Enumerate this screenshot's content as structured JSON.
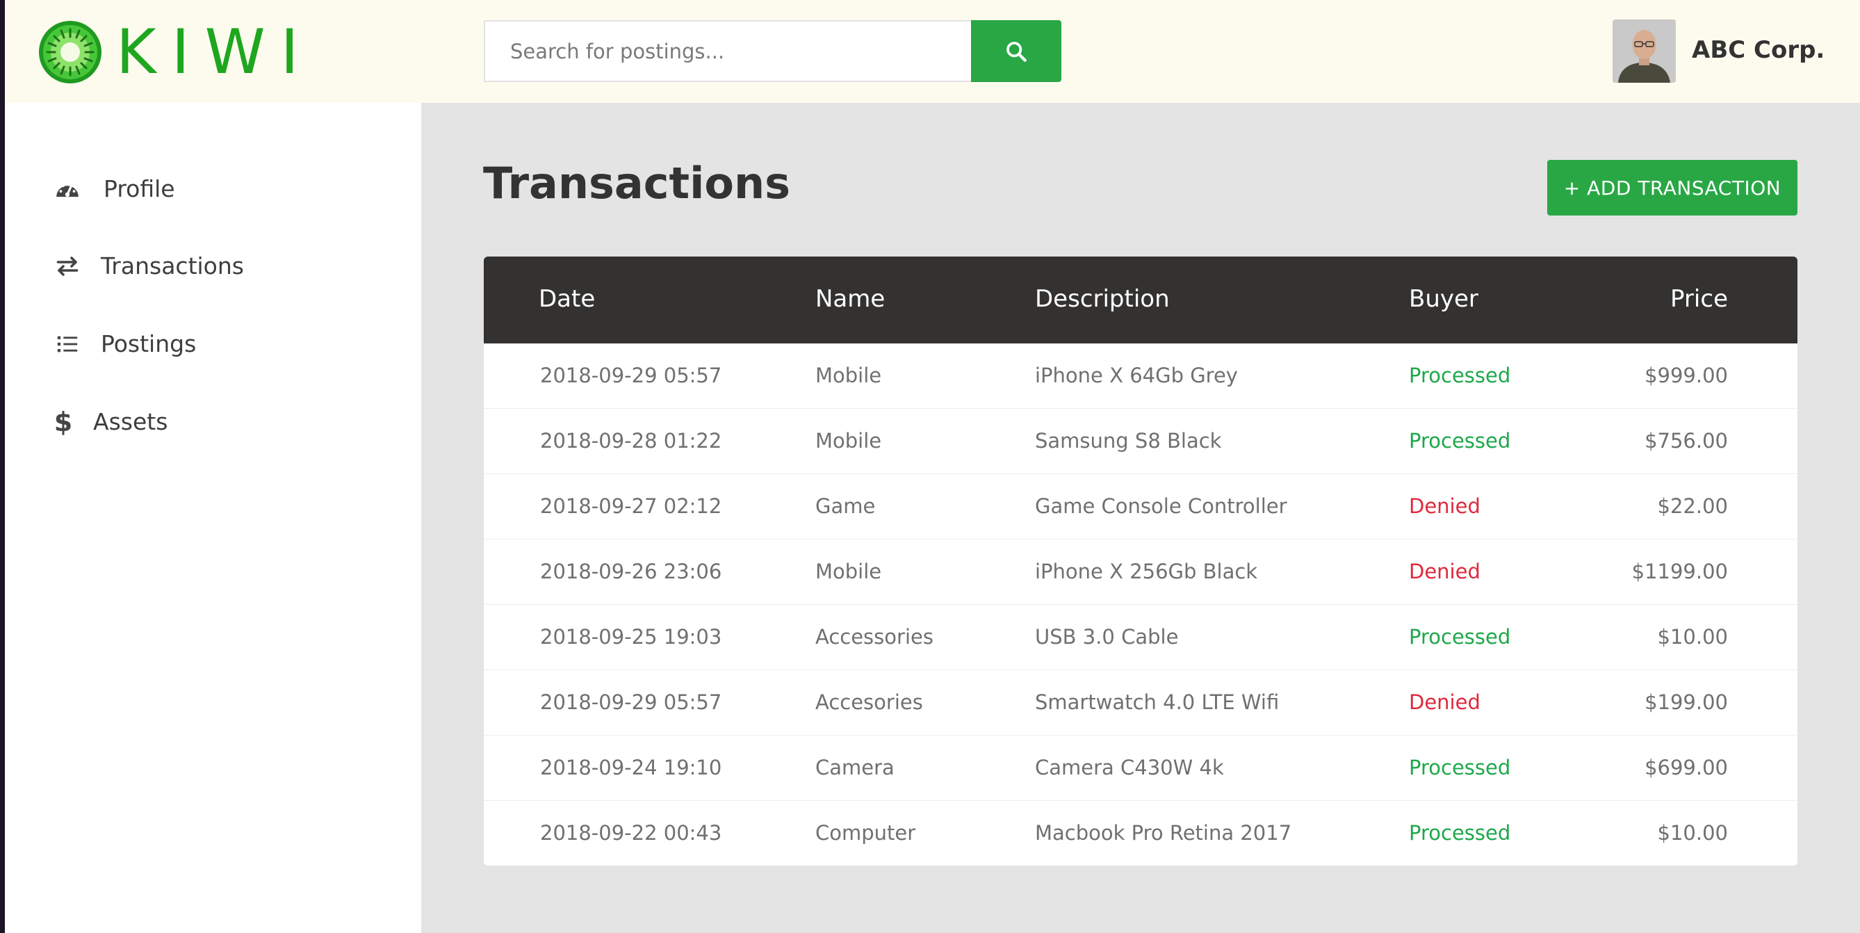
{
  "app": {
    "brand": "KIWI",
    "logo_icon": "kiwi-fruit-logo"
  },
  "header": {
    "search_placeholder": "Search for postings...",
    "search_icon": "search-icon",
    "company_name": "ABC Corp."
  },
  "sidebar": {
    "items": [
      {
        "label": "Profile",
        "icon": "dashboard-gauge-icon"
      },
      {
        "label": "Transactions",
        "icon": "exchange-arrows-icon"
      },
      {
        "label": "Postings",
        "icon": "list-icon"
      },
      {
        "label": "Assets",
        "icon": "dollar-icon"
      }
    ]
  },
  "main": {
    "title": "Transactions",
    "add_button": "+ ADD TRANSACTION",
    "columns": {
      "date": "Date",
      "name": "Name",
      "description": "Description",
      "buyer": "Buyer",
      "price": "Price"
    },
    "rows": [
      {
        "date": "2018-09-29 05:57",
        "name": "Mobile",
        "description": "iPhone X 64Gb Grey",
        "buyer": "Processed",
        "price": "$999.00"
      },
      {
        "date": "2018-09-28 01:22",
        "name": "Mobile",
        "description": "Samsung S8 Black",
        "buyer": "Processed",
        "price": "$756.00"
      },
      {
        "date": "2018-09-27 02:12",
        "name": "Game",
        "description": "Game Console Controller",
        "buyer": "Denied",
        "price": "$22.00"
      },
      {
        "date": "2018-09-26 23:06",
        "name": "Mobile",
        "description": "iPhone X 256Gb Black",
        "buyer": "Denied",
        "price": "$1199.00"
      },
      {
        "date": "2018-09-25 19:03",
        "name": "Accessories",
        "description": "USB 3.0 Cable",
        "buyer": "Processed",
        "price": "$10.00"
      },
      {
        "date": "2018-09-29 05:57",
        "name": "Accesories",
        "description": "Smartwatch 4.0 LTE Wifi",
        "buyer": "Denied",
        "price": "$199.00"
      },
      {
        "date": "2018-09-24 19:10",
        "name": "Camera",
        "description": "Camera C430W 4k",
        "buyer": "Processed",
        "price": "$699.00"
      },
      {
        "date": "2018-09-22 00:43",
        "name": "Computer",
        "description": "Macbook Pro Retina 2017",
        "buyer": "Processed",
        "price": "$10.00"
      }
    ]
  },
  "colors": {
    "accent": "#29a745",
    "processed": "#1ea84a",
    "denied": "#e0283b",
    "header_bg": "#fdfbee",
    "table_head": "#333231"
  }
}
